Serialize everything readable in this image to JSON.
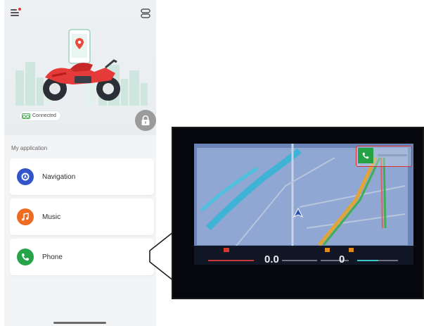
{
  "status": {
    "connected_label": "Connected"
  },
  "section": {
    "title": "My application"
  },
  "apps": [
    {
      "label": "Navigation",
      "icon": "navigation-icon",
      "color": "#3355c9"
    },
    {
      "label": "Music",
      "icon": "music-icon",
      "color": "#ef6b24"
    },
    {
      "label": "Phone",
      "icon": "phone-icon",
      "color": "#27a34a"
    }
  ],
  "dashboard": {
    "speed": "0.0",
    "gear": "0",
    "call_indicator_color": "#d92f2f"
  }
}
